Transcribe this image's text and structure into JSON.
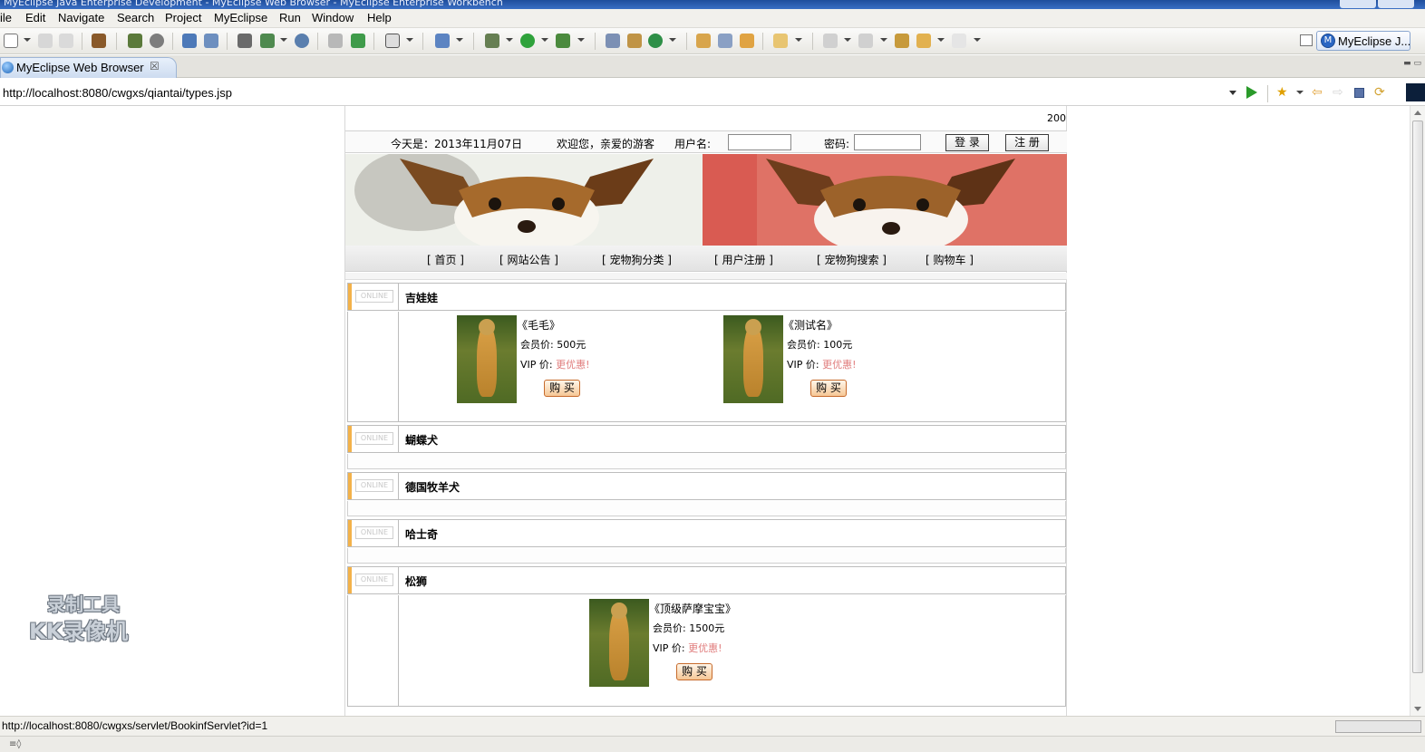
{
  "window": {
    "title": "MyEclipse Java Enterprise Development - MyEclipse Web Browser - MyEclipse Enterprise Workbench"
  },
  "menu": [
    "ile",
    "Edit",
    "Navigate",
    "Search",
    "Project",
    "MyEclipse",
    "Run",
    "Window",
    "Help"
  ],
  "perspective": {
    "label": "MyEclipse J...",
    "icon": "myeclipse-perspective-icon"
  },
  "editor_tab": {
    "label": "MyEclipse Web Browser",
    "close": "☒"
  },
  "address": {
    "url": "http://localhost:8080/cwgxs/qiantai/types.jsp"
  },
  "page": {
    "corner_date": "200",
    "login": {
      "today": "今天是：2013年11月07日",
      "welcome": "欢迎您，亲爱的游客",
      "username_label": "用户名:",
      "username_value": "",
      "password_label": "密码:",
      "password_value": "",
      "login_button": "登 录",
      "register_button": "注 册"
    },
    "nav": [
      "[ 首页 ]",
      "[ 网站公告 ]",
      "[ 宠物狗分类 ]",
      "[ 用户注册 ]",
      "[ 宠物狗搜索 ]",
      "[ 购物车 ]"
    ],
    "online_badge": "ONLINE",
    "categories": [
      {
        "name": "吉娃娃",
        "products": [
          {
            "name": "《毛毛》",
            "price": "会员价: 500元",
            "vip_label": "VIP 价: ",
            "vip_value": "更优惠!",
            "buy": "购 买"
          },
          {
            "name": "《测试名》",
            "price": "会员价: 100元",
            "vip_label": "VIP 价: ",
            "vip_value": "更优惠!",
            "buy": "购 买"
          }
        ]
      },
      {
        "name": "蝴蝶犬",
        "products": []
      },
      {
        "name": "德国牧羊犬",
        "products": []
      },
      {
        "name": "哈士奇",
        "products": []
      },
      {
        "name": "松狮",
        "products": [
          {
            "name": "《顶级萨摩宝宝》",
            "price": "会员价: 1500元",
            "vip_label": "VIP 价: ",
            "vip_value": "更优惠!",
            "buy": "购 买"
          }
        ]
      }
    ]
  },
  "watermark": {
    "line1": "录制工具",
    "line2": "KK录像机"
  },
  "status": {
    "text": "http://localhost:8080/cwgxs/servlet/BookinfServlet?id=1"
  },
  "colors": {
    "accent_orange": "#f3b24a",
    "vip_pink": "#e07d7d",
    "title_blue": "#2a5fb0"
  }
}
